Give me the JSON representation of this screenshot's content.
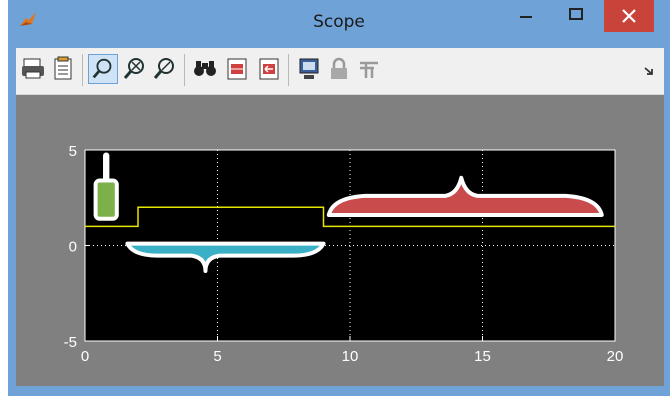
{
  "window": {
    "title": "Scope",
    "colors": {
      "frame": "#6fa3d8",
      "close": "#c8433a",
      "plot_bg": "#000000",
      "panel_bg": "#808080",
      "signal": "#e6e600"
    }
  },
  "toolbar": {
    "buttons": [
      "print-icon",
      "parameters-icon",
      "zoom-icon",
      "zoom-x-icon",
      "zoom-y-icon",
      "autoscale-icon",
      "save-axes-icon",
      "restore-axes-icon",
      "floating-scope-icon",
      "lock-icon",
      "signal-selection-icon"
    ]
  },
  "chart_data": {
    "type": "line",
    "x": [
      0,
      2,
      2,
      9,
      9,
      20
    ],
    "y": [
      1,
      1,
      2,
      2,
      1,
      1
    ],
    "xlim": [
      0,
      20
    ],
    "ylim": [
      -5,
      5
    ],
    "xticks": [
      "0",
      "5",
      "10",
      "15",
      "20"
    ],
    "yticks": [
      "5",
      "0",
      "-5"
    ],
    "grid": true,
    "annotations": [
      {
        "shape": "brush",
        "color": "#7bb04a",
        "x": [
          0.4,
          1.2
        ],
        "y": [
          1.4,
          3.4
        ]
      },
      {
        "shape": "brace-down",
        "color": "#3ab0c6",
        "x": [
          1.6,
          9.0
        ],
        "y": [
          -0.6,
          0.1
        ]
      },
      {
        "shape": "brace-up",
        "color": "#c94b4b",
        "x": [
          9.2,
          19.5
        ],
        "y": [
          1.6,
          2.6
        ]
      }
    ]
  }
}
